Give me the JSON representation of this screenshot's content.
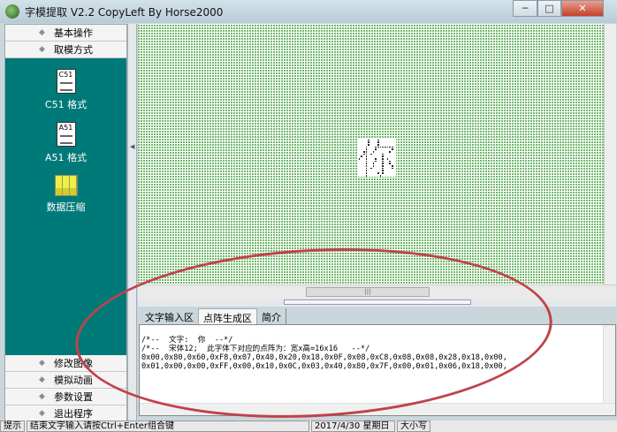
{
  "window": {
    "title": "字模提取 V2.2  CopyLeft By Horse2000",
    "minimize": "─",
    "maximize": "□",
    "close": "✕"
  },
  "sidebar": {
    "top_items": [
      {
        "label": "基本操作"
      },
      {
        "label": "取模方式"
      }
    ],
    "tools": [
      {
        "label": "C51 格式",
        "icon_text": "C51"
      },
      {
        "label": "A51 格式",
        "icon_text": "A51"
      },
      {
        "label": "数据压缩"
      }
    ],
    "bottom_items": [
      {
        "label": "修改图像"
      },
      {
        "label": "模拟动画"
      },
      {
        "label": "参数设置"
      },
      {
        "label": "退出程序"
      }
    ]
  },
  "glyph": {
    "char": "你",
    "bytes": [
      "0x00",
      "0x80",
      "0x60",
      "0xF8",
      "0x07",
      "0x40",
      "0x20",
      "0x18",
      "0x0F",
      "0x08",
      "0xC8",
      "0x08",
      "0x08",
      "0x28",
      "0x18",
      "0x00",
      "0x01",
      "0x00",
      "0x00",
      "0xFF",
      "0x00",
      "0x10",
      "0x0C",
      "0x03",
      "0x40",
      "0x80",
      "0x7F",
      "0x00",
      "0x01",
      "0x06",
      "0x18",
      "0x00"
    ]
  },
  "tabs": [
    {
      "label": "文字输入区"
    },
    {
      "label": "点阵生成区"
    },
    {
      "label": "简介"
    }
  ],
  "output": {
    "lines": [
      "/*--  文字:  你  --*/",
      "/*--  宋体12;  此字体下对应的点阵为：宽x高=16x16   --*/",
      "0x00,0x80,0x60,0xF8,0x07,0x40,0x20,0x18,0x0F,0x08,0xC8,0x08,0x08,0x28,0x18,0x00,",
      "0x01,0x00,0x00,0xFF,0x00,0x10,0x0C,0x03,0x40,0x80,0x7F,0x00,0x01,0x06,0x18,0x00,"
    ]
  },
  "status": {
    "label": "提示",
    "message": "结束文字输入请按Ctrl+Enter组合键",
    "date": "2017/4/30 星期日",
    "caps": "大小写"
  }
}
